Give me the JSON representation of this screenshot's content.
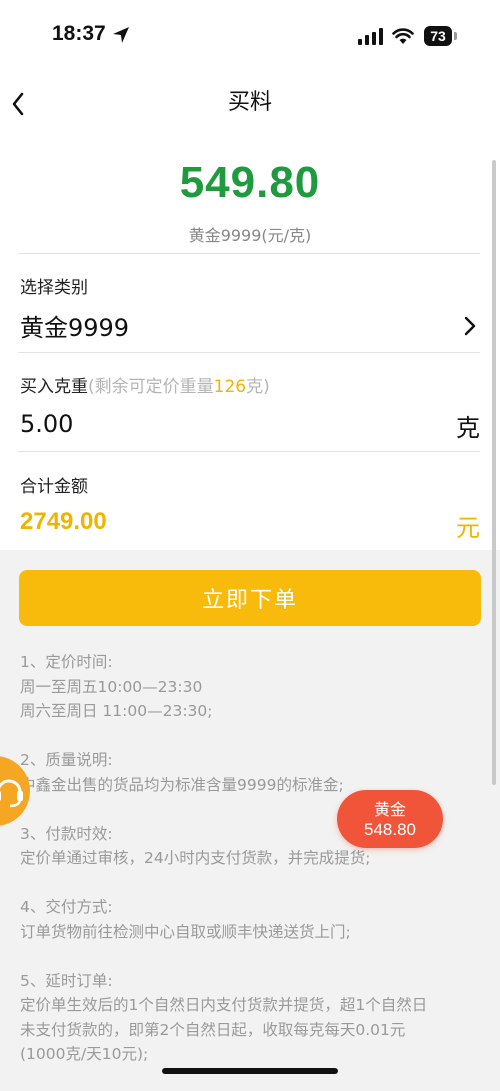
{
  "status": {
    "time": "18:37",
    "battery": "73"
  },
  "nav": {
    "title": "买料"
  },
  "price": {
    "value": "549.80",
    "unit_label": "黄金9999(元/克)"
  },
  "category": {
    "label": "选择类别",
    "value": "黄金9999"
  },
  "weight": {
    "label": "买入克重",
    "hint_prefix": "(剩余可定价重量",
    "hint_value": "126",
    "hint_suffix": "克)",
    "value": "5.00",
    "unit": "克"
  },
  "total": {
    "label": "合计金额",
    "value": "2749.00",
    "unit": "元"
  },
  "order_button": {
    "label": "立即下单"
  },
  "notes": [
    {
      "title": "1、定价时间:",
      "lines": [
        "周一至周五10:00—23:30",
        "周六至周日 11:00—23:30;"
      ]
    },
    {
      "title": "2、质量说明:",
      "lines": [
        "中鑫金出售的货品均为标准含量9999的标准金;"
      ]
    },
    {
      "title": "3、付款时效:",
      "lines": [
        "定价单通过审核，24小时内支付货款，并完成提货;"
      ]
    },
    {
      "title": "4、交付方式:",
      "lines": [
        "订单货物前往检测中心自取或顺丰快递送货上门;"
      ]
    },
    {
      "title": "5、延时订单:",
      "lines": [
        "定价单生效后的1个自然日内支付货款并提货，超1个自然日",
        "未支付货款的，即第2个自然日起，收取每克每天0.01元",
        "(1000克/天10元);"
      ]
    }
  ],
  "gold_badge": {
    "name": "黄金",
    "price": "548.80"
  },
  "colors": {
    "price_green": "#1f9a3f",
    "accent_yellow": "#f8bb0c",
    "badge_red": "#f0553a"
  }
}
